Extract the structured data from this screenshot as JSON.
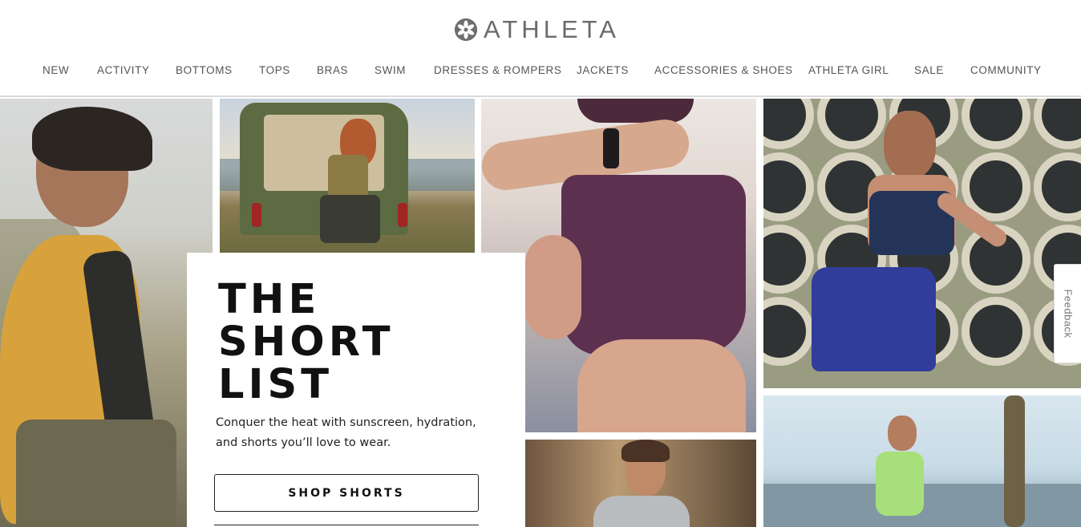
{
  "brand": {
    "name": "ATHLETA",
    "logo_icon": "athleta-flower-logo"
  },
  "nav": {
    "items": [
      {
        "label": "NEW"
      },
      {
        "label": "ACTIVITY"
      },
      {
        "label": "BOTTOMS"
      },
      {
        "label": "TOPS"
      },
      {
        "label": "BRAS"
      },
      {
        "label": "SWIM"
      },
      {
        "label": "DRESSES & ROMPERS"
      },
      {
        "label": "JACKETS"
      },
      {
        "label": "ACCESSORIES & SHOES"
      },
      {
        "label": "ATHLETA GIRL"
      },
      {
        "label": "SALE"
      },
      {
        "label": "COMMUNITY"
      }
    ]
  },
  "promo": {
    "title_line1": "THE",
    "title_line2": "SHORT",
    "title_line3": "LIST",
    "subtitle_line1": "Conquer the heat with sunscreen, hydration,",
    "subtitle_line2": "and shorts you’ll love to wear.",
    "cta_label": "SHOP SHORTS"
  },
  "feedback": {
    "label": "Feedback"
  },
  "colors": {
    "nav_text": "#555555",
    "logo": "#6b6b6b",
    "text_dark": "#111111"
  }
}
